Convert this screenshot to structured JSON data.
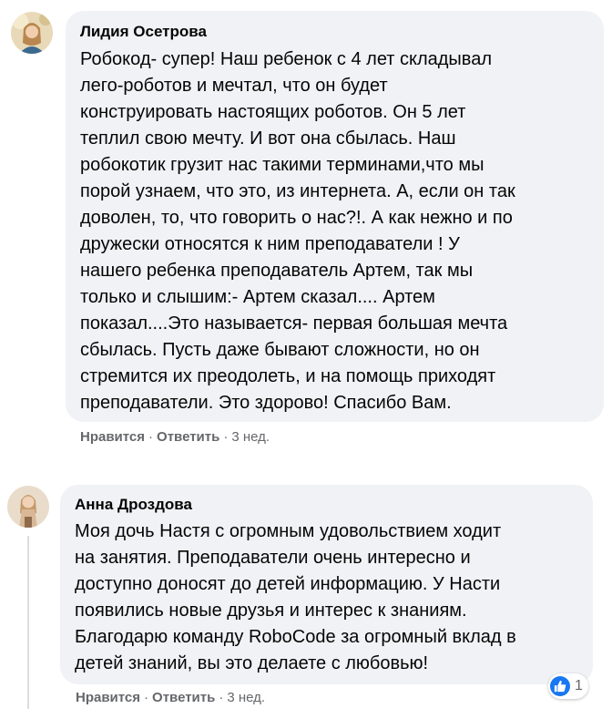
{
  "comments": [
    {
      "author": "Лидия Осетрова",
      "lines": [
        "Робокод- супер! Наш ребенок с 4 лет складывал",
        "лего-роботов и мечтал, что он будет",
        "конструировать настоящих роботов. Он 5 лет",
        "теплил свою мечту. И вот она сбылась. Наш",
        "робокотик грузит нас такими терминами,что мы",
        "порой узнаем, что это, из интернета. А, если он так",
        "доволен, то, что говорить о нас?!. А как нежно и по",
        "дружески относятся к ним преподаватели ! У",
        "нашего ребенка преподаватель Артем, так мы",
        "только и слышим:- Артем сказал.... Артем",
        "показал....Это называется- первая большая мечта",
        "сбылась. Пусть даже бывают сложности, но он",
        "стремится их преодолеть, и на помощь приходят",
        "преподаватели. Это здорово! Спасибо Вам."
      ],
      "like_label": "Нравится",
      "reply_label": "Ответить",
      "time": "3 нед."
    },
    {
      "author": "Анна Дроздова",
      "lines": [
        "Моя дочь Настя с огромным удовольствием ходит",
        "на занятия. Преподаватели очень интересно и",
        "доступно доносят до детей информацию. У Насти",
        "появились новые друзья и интерес к знаниям.",
        "Благодарю команду RoboCode за огромный вклад в",
        "детей знаний, вы это делаете с любовью!"
      ],
      "like_label": "Нравится",
      "reply_label": "Ответить",
      "time": "3 нед.",
      "reaction_icon": "like-icon",
      "reaction_count": "1"
    }
  ],
  "separator": "·",
  "colors": {
    "bubble": "#f0f2f5",
    "meta": "#65676b",
    "like": "#1877f2"
  }
}
